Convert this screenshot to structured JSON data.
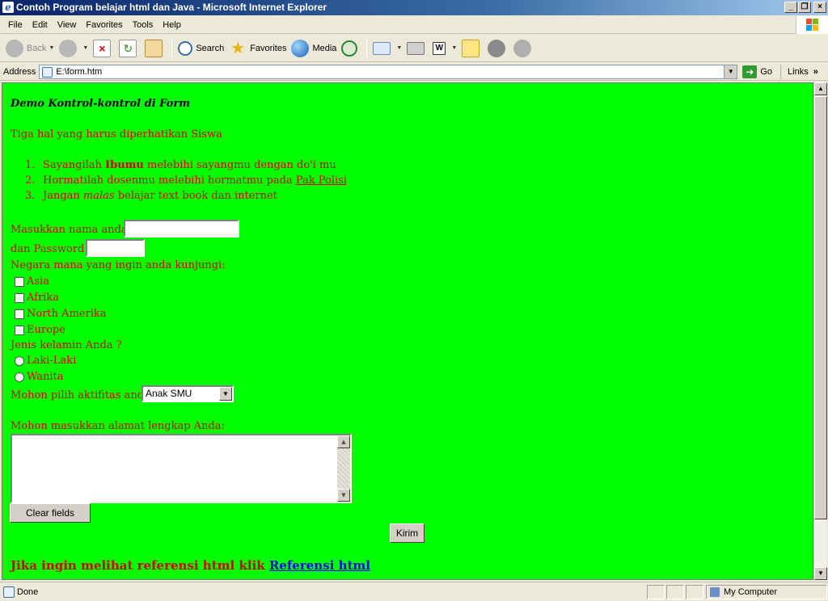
{
  "window": {
    "title": "Contoh Program belajar html dan Java - Microsoft Internet Explorer",
    "minimize": "_",
    "maximize": "❐",
    "close": "×"
  },
  "menu": {
    "items": [
      {
        "label": "File"
      },
      {
        "label": "Edit"
      },
      {
        "label": "View"
      },
      {
        "label": "Favorites"
      },
      {
        "label": "Tools"
      },
      {
        "label": "Help"
      }
    ]
  },
  "toolbar": {
    "back": "Back",
    "search": "Search",
    "favorites": "Favorites",
    "media": "Media"
  },
  "address": {
    "label": "Address",
    "value": "E:\\form.htm",
    "go": "Go",
    "links": "Links"
  },
  "page": {
    "heading": "Demo Kontrol-kontrol di Form",
    "intro": "Tiga hal yang harus diperhatikan Siswa",
    "list": [
      {
        "num": "1.",
        "before": "Sayangilah ",
        "bold": "Ibumu",
        "after": " melebihi sayangmu dengan do'i mu"
      },
      {
        "num": "2.",
        "before": "Hormatilah dosenmu melebihi hormatmu pada ",
        "link": "Pak Polisi"
      },
      {
        "num": "3.",
        "before": "Jangan ",
        "italic": "malas",
        "after": " belajar text book dan internet"
      }
    ],
    "name_label": "Masukkan nama anda",
    "name_value": "",
    "password_label": "dan Password",
    "password_value": "",
    "country_question": "Negara mana yang ingin anda kunjungi:",
    "countries": [
      {
        "label": "Asia",
        "checked": false
      },
      {
        "label": "Afrika",
        "checked": false
      },
      {
        "label": "North Amerika",
        "checked": false
      },
      {
        "label": "Europe",
        "checked": false
      }
    ],
    "gender_question": "Jenis kelamin Anda ?",
    "genders": [
      {
        "label": "Laki-Laki",
        "selected": false
      },
      {
        "label": "Wanita",
        "selected": false
      }
    ],
    "activity_label": "Mohon pilih aktifitas anda",
    "activity_selected": "Anak SMU",
    "address_label": "Mohon masukkan alamat lengkap Anda:",
    "address_value": "",
    "clear_button": "Clear fields",
    "submit_button": "Kirim",
    "footer_text": "Jika ingin melihat referensi html klik",
    "footer_link": "Referensi html"
  },
  "status": {
    "text": "Done",
    "zone": "My Computer"
  },
  "colors": {
    "page_background": "#00ff00",
    "text_red": "#d40000",
    "link_blue": "#0000ee"
  }
}
